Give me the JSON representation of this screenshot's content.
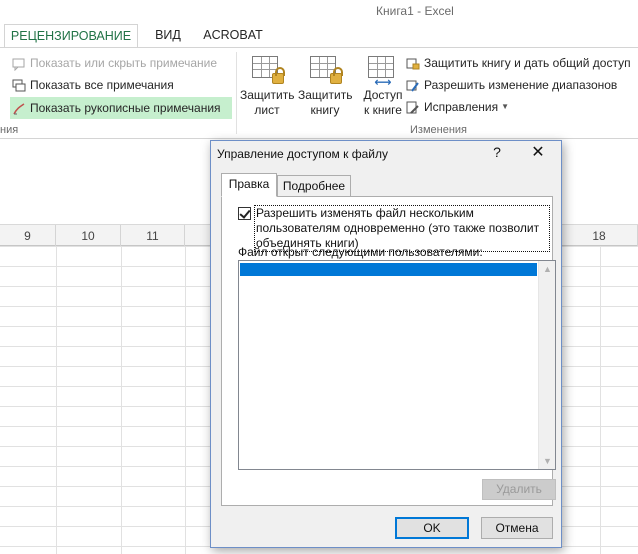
{
  "window": {
    "title": "Книга1 - Excel"
  },
  "ribbon": {
    "tabs": [
      {
        "label": "РЕЦЕНЗИРОВАНИЕ",
        "active": true
      },
      {
        "label": "ВИД",
        "active": false
      },
      {
        "label": "ACROBAT",
        "active": false
      }
    ],
    "comments_group": {
      "toggle_comment": "Показать или скрыть примечание",
      "show_all": "Показать все примечания",
      "show_ink": "Показать рукописные примечания",
      "label": "ния"
    },
    "protect_buttons": {
      "protect_sheet_line1": "Защитить",
      "protect_sheet_line2": "лист",
      "protect_book_line1": "Защитить",
      "protect_book_line2": "книгу",
      "access_book_line1": "Доступ",
      "access_book_line2": "к книге"
    },
    "changes_group": {
      "protect_share": "Защитить книгу и дать общий доступ",
      "allow_ranges": "Разрешить изменение диапазонов",
      "track_changes": "Исправления",
      "label": "Изменения"
    },
    "colors": {
      "accent": "#217346",
      "highlight": "#c6efce"
    }
  },
  "sheet": {
    "columns": [
      "9",
      "10",
      "11",
      "18"
    ]
  },
  "dialog": {
    "title": "Управление доступом к файлу",
    "help": "?",
    "close": "✕",
    "tabs": [
      "Правка",
      "Подробнее"
    ],
    "multi_user": {
      "checked": true,
      "label": "Разрешить изменять файл нескольким пользователям одновременно (это также позволит объединять книги)"
    },
    "users_label": "Файл открыт следующими пользователями:",
    "remove_label": "Удалить",
    "ok_label": "OK",
    "cancel_label": "Отмена",
    "selection_color": "#0078d7"
  }
}
